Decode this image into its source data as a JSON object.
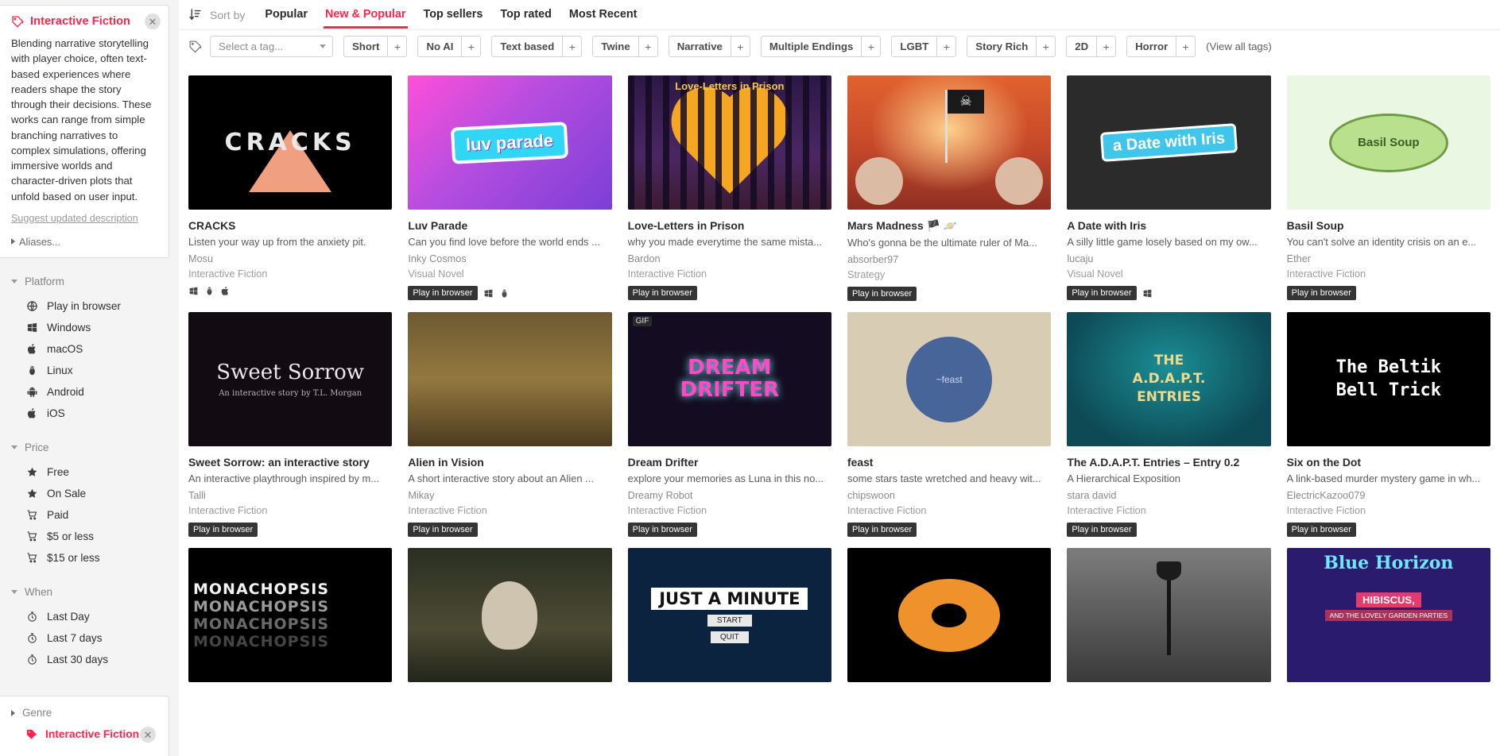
{
  "sidebar": {
    "genre_card": {
      "title": "Interactive Fiction",
      "description": "Blending narrative storytelling with player choice, often text-based experiences where readers shape the story through their decisions. These works can range from simple branching narratives to complex simulations, offering immersive worlds and character-driven plots that unfold based on user input.",
      "suggest_link": "Suggest updated description",
      "aliases_label": "Aliases...",
      "close_label": "✕"
    },
    "groups": [
      {
        "heading": "Platform",
        "items": [
          {
            "label": "Play in browser",
            "icon": "globe-icon"
          },
          {
            "label": "Windows",
            "icon": "windows-icon"
          },
          {
            "label": "macOS",
            "icon": "apple-icon"
          },
          {
            "label": "Linux",
            "icon": "linux-icon"
          },
          {
            "label": "Android",
            "icon": "android-icon"
          },
          {
            "label": "iOS",
            "icon": "apple-icon"
          }
        ]
      },
      {
        "heading": "Price",
        "items": [
          {
            "label": "Free",
            "icon": "star-icon"
          },
          {
            "label": "On Sale",
            "icon": "star-icon"
          },
          {
            "label": "Paid",
            "icon": "cart-icon"
          },
          {
            "label": "$5 or less",
            "icon": "cart-icon"
          },
          {
            "label": "$15 or less",
            "icon": "cart-icon"
          }
        ]
      },
      {
        "heading": "When",
        "items": [
          {
            "label": "Last Day",
            "icon": "clock-icon"
          },
          {
            "label": "Last 7 days",
            "icon": "clock-icon"
          },
          {
            "label": "Last 30 days",
            "icon": "clock-icon"
          }
        ]
      }
    ],
    "genre_bottom": {
      "heading": "Genre",
      "selected": "Interactive Fiction",
      "close_label": "✕"
    }
  },
  "sortbar": {
    "label": "Sort by",
    "options": [
      {
        "label": "Popular",
        "active": false
      },
      {
        "label": "New & Popular",
        "active": true
      },
      {
        "label": "Top sellers",
        "active": false
      },
      {
        "label": "Top rated",
        "active": false
      },
      {
        "label": "Most Recent",
        "active": false
      }
    ]
  },
  "tagbar": {
    "select_placeholder": "Select a tag...",
    "chips": [
      "Short",
      "No AI",
      "Text based",
      "Twine",
      "Narrative",
      "Multiple Endings",
      "LGBT",
      "Story Rich",
      "2D",
      "Horror"
    ],
    "plus_label": "+",
    "view_all": "(View all tags)"
  },
  "games": [
    {
      "title": "CRACKS",
      "desc": "Listen your way up from the anxiety pit.",
      "author": "Mosu",
      "genre": "Interactive Fiction",
      "badge": "",
      "platforms": [
        "windows-icon",
        "linux-icon",
        "apple-icon"
      ],
      "art": "t-cracks"
    },
    {
      "title": "Luv Parade",
      "desc": "Can you find love before the world ends ...",
      "author": "Inky Cosmos",
      "genre": "Visual Novel",
      "badge": "Play in browser",
      "platforms": [
        "windows-icon",
        "linux-icon"
      ],
      "art": "t-luv"
    },
    {
      "title": "Love-Letters in Prison",
      "desc": "why you made everytime the same mista...",
      "author": "Bardon",
      "genre": "Interactive Fiction",
      "badge": "Play in browser",
      "platforms": [],
      "art": "t-prison"
    },
    {
      "title": "Mars Madness 🏴 🪐",
      "desc": "Who's gonna be the ultimate ruler of Ma...",
      "author": "absorber97",
      "genre": "Strategy",
      "badge": "Play in browser",
      "platforms": [],
      "art": "t-mars"
    },
    {
      "title": "A Date with Iris",
      "desc": "A silly little game losely based on my ow...",
      "author": "lucaju",
      "genre": "Visual Novel",
      "badge": "Play in browser",
      "platforms": [
        "windows-icon"
      ],
      "art": "t-iris"
    },
    {
      "title": "Basil Soup",
      "desc": "You can't solve an identity crisis on an e...",
      "author": "Ether",
      "genre": "Interactive Fiction",
      "badge": "Play in browser",
      "platforms": [],
      "art": "t-basil"
    },
    {
      "title": "Sweet Sorrow: an interactive story",
      "desc": "An interactive playthrough inspired by m...",
      "author": "Talli",
      "genre": "Interactive Fiction",
      "badge": "Play in browser",
      "platforms": [],
      "art": "t-sweet"
    },
    {
      "title": "Alien in Vision",
      "desc": "A short interactive story about an Alien ...",
      "author": "Mikay",
      "genre": "Interactive Fiction",
      "badge": "Play in browser",
      "platforms": [],
      "art": "t-alien"
    },
    {
      "title": "Dream Drifter",
      "desc": "explore your memories as Luna in this no...",
      "author": "Dreamy Robot",
      "genre": "Interactive Fiction",
      "badge": "Play in browser",
      "platforms": [],
      "art": "t-dream"
    },
    {
      "title": "feast",
      "desc": "some stars taste wretched and heavy wit...",
      "author": "chipswoon",
      "genre": "Interactive Fiction",
      "badge": "Play in browser",
      "platforms": [],
      "art": "t-feast"
    },
    {
      "title": "The A.D.A.P.T. Entries – Entry 0.2",
      "desc": "A Hierarchical Exposition",
      "author": "stara david",
      "genre": "Interactive Fiction",
      "badge": "Play in browser",
      "platforms": [],
      "art": "t-adapt"
    },
    {
      "title": "Six on the Dot",
      "desc": "A link-based murder mystery game in wh...",
      "author": "ElectricKazoo079",
      "genre": "Interactive Fiction",
      "badge": "Play in browser",
      "platforms": [],
      "art": "t-beltik"
    },
    {
      "title": "",
      "desc": "",
      "author": "",
      "genre": "",
      "badge": "",
      "platforms": [],
      "art": "t-mono"
    },
    {
      "title": "",
      "desc": "",
      "author": "",
      "genre": "",
      "badge": "",
      "platforms": [],
      "art": "t-deer"
    },
    {
      "title": "",
      "desc": "",
      "author": "",
      "genre": "",
      "badge": "",
      "platforms": [],
      "art": "t-minute"
    },
    {
      "title": "",
      "desc": "",
      "author": "",
      "genre": "",
      "badge": "",
      "platforms": [],
      "art": "t-donut"
    },
    {
      "title": "",
      "desc": "",
      "author": "",
      "genre": "",
      "badge": "",
      "platforms": [],
      "art": "t-lamp"
    },
    {
      "title": "",
      "desc": "",
      "author": "",
      "genre": "",
      "badge": "",
      "platforms": [],
      "art": "t-blue"
    }
  ],
  "artwork_text": {
    "cracks": "CRACKS",
    "luv": "luv parade",
    "prison": "Love-Letters in Prison",
    "basil": "Basil Soup",
    "iris": "a Date with Iris",
    "sweet_title": "Sweet Sorrow",
    "sweet_sub": "An interactive story by T.L. Morgan",
    "dream": "DREAM DRIFTER",
    "gif": "GIF",
    "feast": "~feast",
    "adapt": "THE A.D.A.P.T. ENTRIES",
    "beltik": "The Beltik Bell Trick",
    "mono": "MONACHOPSIS",
    "minute": "JUST A MINUTE",
    "minute_start": "START",
    "minute_quit": "QUIT",
    "blue": "Blue Horizon",
    "blue_hib": "HIBISCUS,",
    "blue_sub": "AND THE LOVELY GARDEN PARTIES"
  },
  "colors": {
    "accent": "#ff2449",
    "sidebar_bg": "#f4f4f4",
    "badge_bg": "#353535"
  }
}
